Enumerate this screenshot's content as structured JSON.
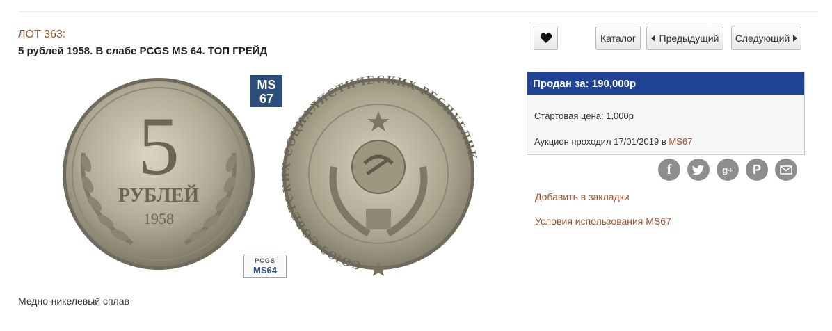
{
  "lot": {
    "label": "ЛОТ 363:",
    "title": "5 рублей 1958. В слабе PCGS MS 64. ТОП ГРЕЙД",
    "caption": "Медно-никелевый сплав"
  },
  "coin": {
    "obverse": {
      "denomination": "5",
      "unit": "РУБЛЕЙ",
      "year": "1958"
    },
    "reverse": {
      "legend": "СОЮЗ СОВЕТСКИХ СОЦИАЛИСТИЧЕСКИХ РЕСПУБЛИК"
    },
    "ms_logo": {
      "top": "MS",
      "bottom": "67"
    },
    "grade_badge": {
      "brand": "PCGS",
      "grade": "MS64"
    }
  },
  "nav": {
    "favorite_icon": "heart-icon",
    "catalog_label": "Каталог",
    "prev_label": "Предыдущий",
    "next_label": "Следующий"
  },
  "sale": {
    "sold_label": "Продан за: 190,000р",
    "start_price": "Стартовая цена: 1,000р",
    "auction_text": "Аукцион проходил 17/01/2019 в ",
    "auction_link": "MS67",
    "header_color": "#1f4495"
  },
  "share": {
    "icons": [
      "facebook-icon",
      "twitter-icon",
      "google-plus-icon",
      "pinterest-icon",
      "mail-icon"
    ]
  },
  "links": {
    "bookmark": "Добавить в закладки",
    "terms": "Условия использования MS67"
  }
}
